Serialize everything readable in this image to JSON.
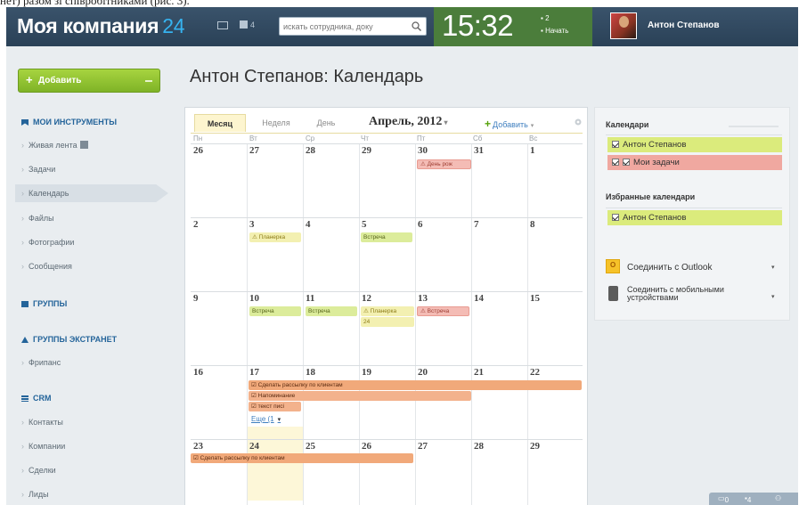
{
  "caption_fragment": "нет) разом зі співробітниками (рис. 3).",
  "header": {
    "logo_text": "Моя компания",
    "logo_number": "24",
    "messages_count": "4",
    "search_placeholder": "искать сотрудника, доку",
    "clock": "15:32",
    "clock_counter": "2",
    "start_label": "Начать",
    "user_name": "Антон Степанов"
  },
  "sidebar": {
    "add_button": "Добавить",
    "sections": [
      {
        "title": "МОИ ИНСТРУМЕНТЫ",
        "icon": "flag-icon"
      },
      {
        "title": "ГРУППЫ",
        "icon": "group-icon"
      },
      {
        "title": "ГРУППЫ ЭКСТРАНЕТ",
        "icon": "extranet-icon"
      },
      {
        "title": "CRM",
        "icon": "crm-icon"
      }
    ],
    "items": [
      {
        "label": "Живая лента"
      },
      {
        "label": "Задачи"
      },
      {
        "label": "Календарь"
      },
      {
        "label": "Файлы"
      },
      {
        "label": "Фотографии"
      },
      {
        "label": "Сообщения"
      },
      {
        "label": "Фрипанс"
      },
      {
        "label": "Контакты"
      },
      {
        "label": "Компании"
      },
      {
        "label": "Сделки"
      },
      {
        "label": "Лиды"
      }
    ]
  },
  "page_title": "Антон Степанов: Календарь",
  "calendar": {
    "tabs": [
      "Месяц",
      "Неделя",
      "День"
    ],
    "month_title": "Апрель, 2012",
    "add_label": "Добавить",
    "weekdays": [
      "Пн",
      "Вт",
      "Ср",
      "Чт",
      "Пт",
      "Сб",
      "Вс"
    ],
    "weeks": [
      [
        "26",
        "27",
        "28",
        "29",
        "30",
        "31",
        "1"
      ],
      [
        "2",
        "3",
        "4",
        "5",
        "6",
        "7",
        "8"
      ],
      [
        "9",
        "10",
        "11",
        "12",
        "13",
        "14",
        "15"
      ],
      [
        "16",
        "17",
        "18",
        "19",
        "20",
        "21",
        "22"
      ],
      [
        "23",
        "24",
        "25",
        "26",
        "27",
        "28",
        "29"
      ]
    ],
    "events": {
      "w0_fri": "День рож",
      "w1_tue": "Планерка",
      "w1_thu": "Встреча",
      "w2_tue": "Встреча",
      "w2_wed": "Встреча",
      "w2_thu": "Планерка",
      "w2_thu_2": "24",
      "w2_fri": "Встреча",
      "w3_task1": "Сделать рассылку по клиентам",
      "w3_task2": "Напоминание",
      "w3_task3": "текст писі",
      "w3_more": "Еще (1",
      "w4_task1": "Сделать рассылку по клиентам"
    }
  },
  "right_panel": {
    "calendars_title": "Календари",
    "calendars": [
      {
        "label": "Антон Степанов",
        "color": "#dbeb7c"
      },
      {
        "label": "Мои задачи",
        "color": "#f0a8a0"
      }
    ],
    "favorites_title": "Избранные календари",
    "favorites": [
      {
        "label": "Антон Степанов",
        "color": "#dbeb7c"
      }
    ],
    "links": [
      {
        "label": "Соединить с Outlook"
      },
      {
        "label_line1": "Соединить с мобильными",
        "label_line2": "устройствами"
      }
    ]
  },
  "bottom_bar": {
    "count_1": "0",
    "count_2": "4"
  }
}
